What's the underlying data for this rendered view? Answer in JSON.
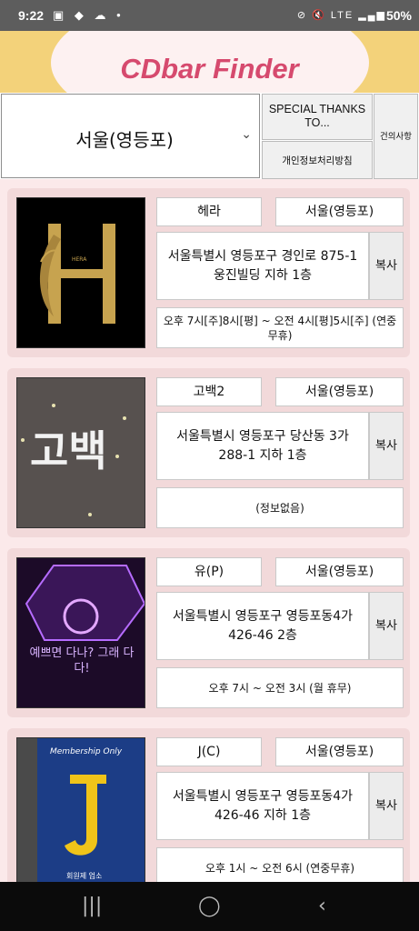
{
  "status_bar": {
    "time": "9:22",
    "battery": "50%",
    "network": "LTE"
  },
  "app": {
    "title": "CDbar Finder"
  },
  "controls": {
    "region_selected": "서울(영등포)",
    "special_thanks": "SPECIAL THANKS TO...",
    "privacy_policy": "개인정보처리방침",
    "suggestion": "건의사항"
  },
  "listings": [
    {
      "name": "헤라",
      "region": "서울(영등포)",
      "address": "서울특별시 영등포구 경인로 875-1 웅진빌딩 지하 1층",
      "copy_label": "복사",
      "hours": "오후 7시[주]8시[평] ~ 오전 4시[평]5시[주] (연중무휴)",
      "thumb_text": "HERA"
    },
    {
      "name": "고백2",
      "region": "서울(영등포)",
      "address": "서울특별시 영등포구 당산동 3가 288-1 지하 1층",
      "copy_label": "복사",
      "hours": "(정보없음)",
      "thumb_text": "고백"
    },
    {
      "name": "유(P)",
      "region": "서울(영등포)",
      "address": "서울특별시 영등포구 영등포동4가 426-46 2층",
      "copy_label": "복사",
      "hours": "오후 7시 ~ 오전 3시 (월 휴무)",
      "thumb_text": "예쁘면 다나? 그래 다다!"
    },
    {
      "name": "J(C)",
      "region": "서울(영등포)",
      "address": "서울특별시 영등포구 영등포동4가 426-46 지하 1층",
      "copy_label": "복사",
      "hours": "오후 1시 ~ 오전 6시 (연중무휴)",
      "thumb_text": "Membership Only",
      "thumb_sub": "회원제 업소"
    }
  ],
  "colors": {
    "title": "#d64a6e",
    "header_bg": "#f3d27a",
    "card_bg": "#f2d9da"
  }
}
